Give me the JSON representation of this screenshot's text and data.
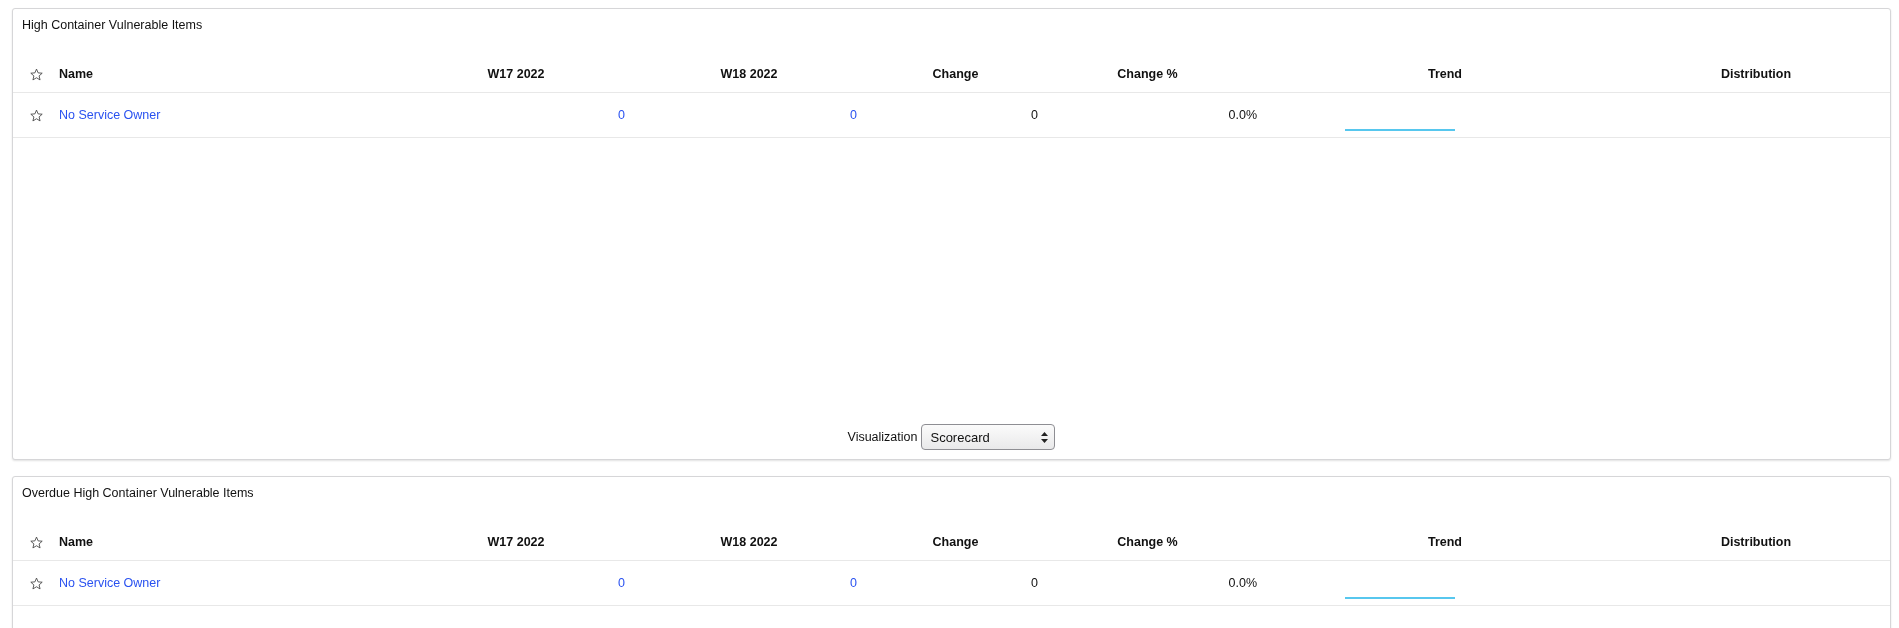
{
  "panels": [
    {
      "title": "High Container Vulnerable Items",
      "columns": [
        "Name",
        "W17 2022",
        "W18 2022",
        "Change",
        "Change %",
        "Trend",
        "Distribution"
      ],
      "rows": [
        {
          "starred": false,
          "name": "No Service Owner",
          "w17": "0",
          "w18": "0",
          "change": "0",
          "change_pct": "0.0%"
        }
      ],
      "visualization": {
        "label": "Visualization",
        "value": "Scorecard"
      }
    },
    {
      "title": "Overdue High Container Vulnerable Items",
      "columns": [
        "Name",
        "W17 2022",
        "W18 2022",
        "Change",
        "Change %",
        "Trend",
        "Distribution"
      ],
      "rows": [
        {
          "starred": false,
          "name": "No Service Owner",
          "w17": "0",
          "w18": "0",
          "change": "0",
          "change_pct": "0.0%"
        }
      ]
    }
  ]
}
